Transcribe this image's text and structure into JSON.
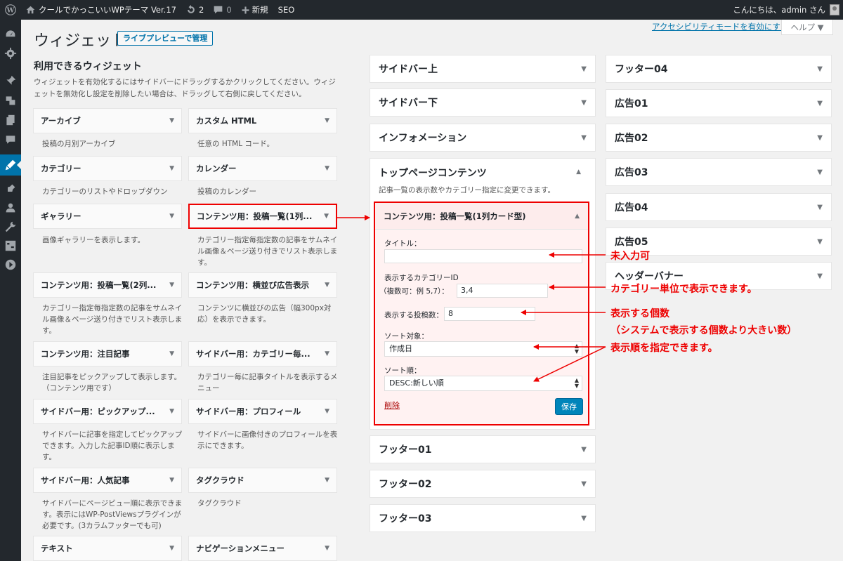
{
  "adminbar": {
    "site_name": "クールでかっこいいWPテーマ Ver.17",
    "updates_count": "2",
    "comments_count": "0",
    "new_label": "新規",
    "seo_label": "SEO",
    "greeting": "こんにちは、admin さん"
  },
  "header": {
    "title": "ウィジェット",
    "live_preview": "ライブプレビューで管理",
    "a11y_link": "アクセシビリティモードを有効にする",
    "help": "ヘルプ ▼"
  },
  "available": {
    "heading": "利用できるウィジェット",
    "description": "ウィジェットを有効化するにはサイドバーにドラッグするかクリックしてください。ウィジェットを無効化し設定を削除したい場合は、ドラッグして右側に戻してください。",
    "widgets": [
      {
        "title": "アーカイブ",
        "desc": "投稿の月別アーカイブ"
      },
      {
        "title": "カスタム HTML",
        "desc": "任意の HTML コード。"
      },
      {
        "title": "カテゴリー",
        "desc": "カテゴリーのリストやドロップダウン"
      },
      {
        "title": "カレンダー",
        "desc": "投稿のカレンダー"
      },
      {
        "title": "ギャラリー",
        "desc": "画像ギャラリーを表示します。"
      },
      {
        "title": "コンテンツ用：投稿一覧(1列...",
        "desc": "カテゴリー指定毎指定数の記事をサムネイル画像＆ページ送り付きでリスト表示します。"
      },
      {
        "title": "コンテンツ用：投稿一覧(2列...",
        "desc": "カテゴリー指定毎指定数の記事をサムネイル画像＆ページ送り付きでリスト表示します。"
      },
      {
        "title": "コンテンツ用：横並び広告表示",
        "desc": "コンテンツに横並びの広告（幅300px対応）を表示できます。"
      },
      {
        "title": "コンテンツ用：注目記事",
        "desc": "注目記事をピックアップして表示します。（コンテンツ用です）"
      },
      {
        "title": "サイドバー用：カテゴリー毎...",
        "desc": "カテゴリー毎に記事タイトルを表示するメニュー"
      },
      {
        "title": "サイドバー用：ピックアップ...",
        "desc": "サイドバーに記事を指定してピックアップできます。入力した記事ID順に表示します。"
      },
      {
        "title": "サイドバー用：プロフィール",
        "desc": "サイドバーに画像付きのプロフィールを表示にできます。"
      },
      {
        "title": "サイドバー用：人気記事",
        "desc": "サイドバーにページビュー順に表示できます。表示にはWP-PostViewsプラグインが必要です。(3カラムフッターでも可)"
      },
      {
        "title": "タグクラウド",
        "desc": "タグクラウド"
      },
      {
        "title": "テキスト",
        "desc": ""
      },
      {
        "title": "ナビゲーションメニュー",
        "desc": ""
      }
    ]
  },
  "sidebars_mid": {
    "top": [
      "サイドバー上",
      "サイドバー下",
      "インフォメーション"
    ],
    "open": {
      "title": "トップページコンテンツ",
      "desc": "記事一覧の表示数やカテゴリー指定に変更できます。"
    },
    "bottom": [
      "フッター01",
      "フッター02",
      "フッター03"
    ]
  },
  "sidebars_right": [
    "フッター04",
    "広告01",
    "広告02",
    "広告03",
    "広告04",
    "広告05",
    "ヘッダーバナー"
  ],
  "widget_form": {
    "title": "コンテンツ用：投稿一覧(1列カード型)",
    "title_label": "タイトル：",
    "title_value": "",
    "category_label": "表示するカテゴリーID",
    "category_sub": "（複数可：例 5,7）：",
    "category_value": "3,4",
    "count_label": "表示する投稿数：",
    "count_value": "8",
    "sort_target_label": "ソート対象：",
    "sort_target_value": "作成日",
    "sort_order_label": "ソート順：",
    "sort_order_value": "DESC:新しい順",
    "delete": "削除",
    "save": "保存"
  },
  "annotations": {
    "a1": "未入力可",
    "a2": "カテゴリー単位で表示できます。",
    "a3": "表示する個数",
    "a4": "（システムで表示する個数より大きい数）",
    "a5": "表示順を指定できます。"
  },
  "colors": {
    "annotation_red": "#ee0000",
    "accent_blue": "#0073aa",
    "admin_dark": "#23282d"
  }
}
